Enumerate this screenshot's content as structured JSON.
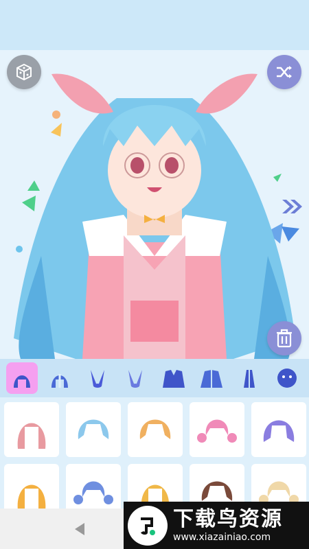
{
  "stage": {
    "character": "anime-girl-preview",
    "colors": {
      "hair": "#7cc8ec",
      "outfit": "#f7a3b4",
      "background": "#e6f3fc"
    }
  },
  "controls": {
    "randomize_icon": "dice-icon",
    "shuffle_icon": "shuffle-icon",
    "next_icon": "double-chevron-icon",
    "delete_icon": "trash-icon"
  },
  "tabs": [
    {
      "icon": "hair-front-icon",
      "active": true
    },
    {
      "icon": "hair-back-icon",
      "active": false
    },
    {
      "icon": "ears-icon",
      "active": false
    },
    {
      "icon": "ears-alt-icon",
      "active": false
    },
    {
      "icon": "outfit-icon",
      "active": false
    },
    {
      "icon": "outfit-alt-icon",
      "active": false
    },
    {
      "icon": "accessory-icon",
      "active": false
    },
    {
      "icon": "face-icon",
      "active": false
    }
  ],
  "items": [
    {
      "color": "#e89aa0",
      "style": "long"
    },
    {
      "color": "#8cc8ec",
      "style": "short"
    },
    {
      "color": "#f0b060",
      "style": "short"
    },
    {
      "color": "#f08ab8",
      "style": "twintail"
    },
    {
      "color": "#8a7de0",
      "style": "bob"
    },
    {
      "color": "#f4b040",
      "style": "long"
    },
    {
      "color": "#6f8fe0",
      "style": "twintail"
    },
    {
      "color": "#f0b848",
      "style": "long"
    },
    {
      "color": "#7a4a3a",
      "style": "short"
    },
    {
      "color": "#f0d8a8",
      "style": "twintail"
    }
  ],
  "watermark": {
    "title": "下载鸟资源",
    "url": "www.xiazainiao.com"
  }
}
